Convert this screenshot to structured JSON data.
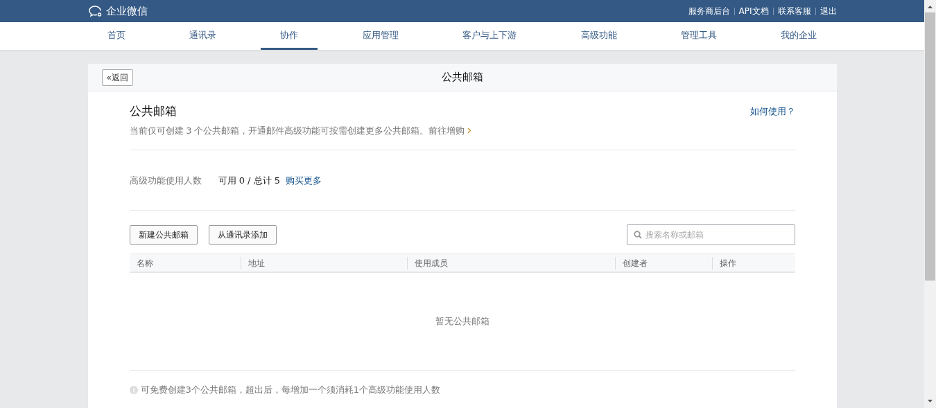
{
  "brand": {
    "name": "企业微信"
  },
  "top_links": [
    "服务商后台",
    "API文档",
    "联系客服",
    "退出"
  ],
  "tabs": [
    {
      "label": "首页",
      "selected": false
    },
    {
      "label": "通讯录",
      "selected": false
    },
    {
      "label": "协作",
      "selected": true
    },
    {
      "label": "应用管理",
      "selected": false
    },
    {
      "label": "客户与上下游",
      "selected": false
    },
    {
      "label": "高级功能",
      "selected": false
    },
    {
      "label": "管理工具",
      "selected": false
    },
    {
      "label": "我的企业",
      "selected": false
    }
  ],
  "header": {
    "back_button": "«返回",
    "title": "公共邮箱"
  },
  "intro": {
    "title": "公共邮箱",
    "help_link": "如何使用？",
    "description": "当前仅可创建 3 个公共邮箱，开通邮件高级功能可按需创建更多公共邮箱。",
    "upgrade_link": "前往增购"
  },
  "quota": {
    "label": "高级功能使用人数",
    "value": "可用 0 / 总计 5",
    "buy_link": "购买更多"
  },
  "actions": [
    "新建公共邮箱",
    "从通讯录添加"
  ],
  "search": {
    "placeholder": "搜索名称或邮箱"
  },
  "table": {
    "columns": [
      "名称",
      "地址",
      "使用成员",
      "创建者",
      "操作"
    ],
    "empty_text": "暂无公共邮箱"
  },
  "note": "可免费创建3个公共邮箱，超出后，每增加一个须消耗1个高级功能使用人数"
}
